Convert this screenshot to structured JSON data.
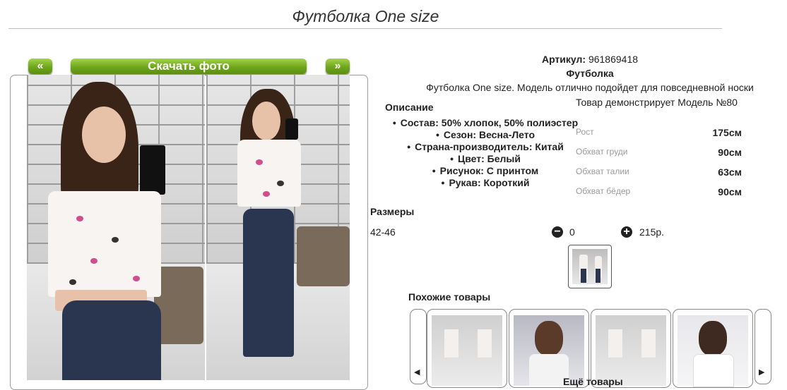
{
  "page_title": "Футболка One size",
  "gallery": {
    "prev_label": "«",
    "download_label": "Скачать фото",
    "next_label": "»"
  },
  "product": {
    "article_label": "Артикул:",
    "article_value": "961869418",
    "name": "Футболка",
    "description": "Футболка One size. Модель отлично подойдет для повседневной носки",
    "model_text": "Товар демонстрирует Модель №80"
  },
  "description_block": {
    "title": "Описание",
    "items": [
      "Состав: 50% хлопок, 50% полиэстер",
      "Сезон: Весна-Лето",
      "Страна-производитель: Китай",
      "Цвет: Белый",
      "Рисунок: С принтом",
      "Рукав: Короткий"
    ]
  },
  "measurements": [
    {
      "label": "Рост",
      "value": "175см"
    },
    {
      "label": "Обхват груди",
      "value": "90см"
    },
    {
      "label": "Обхват талии",
      "value": "63см"
    },
    {
      "label": "Обхват бёдер",
      "value": "90см"
    }
  ],
  "sizes": {
    "heading": "Размеры",
    "size": "42-46",
    "quantity": "0",
    "price": "215р."
  },
  "similar": {
    "heading": "Похожие товары",
    "more_label": "Ещё товары"
  }
}
